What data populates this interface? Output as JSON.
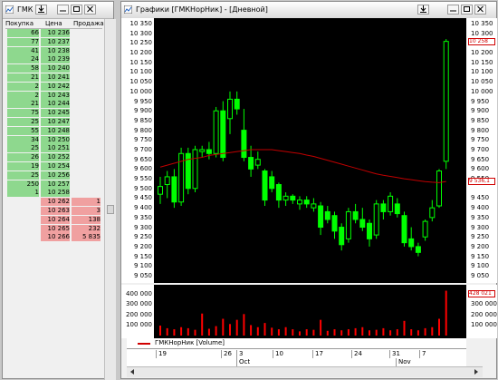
{
  "orderbook": {
    "title": "ГМК",
    "columns": [
      "Покупка",
      "Цена",
      "Продажа"
    ],
    "rows": [
      {
        "buy": "66",
        "price": "10 236",
        "sell": ""
      },
      {
        "buy": "77",
        "price": "10 237",
        "sell": ""
      },
      {
        "buy": "41",
        "price": "10 238",
        "sell": ""
      },
      {
        "buy": "24",
        "price": "10 239",
        "sell": ""
      },
      {
        "buy": "58",
        "price": "10 240",
        "sell": ""
      },
      {
        "buy": "21",
        "price": "10 241",
        "sell": ""
      },
      {
        "buy": "2",
        "price": "10 242",
        "sell": ""
      },
      {
        "buy": "2",
        "price": "10 243",
        "sell": ""
      },
      {
        "buy": "21",
        "price": "10 244",
        "sell": ""
      },
      {
        "buy": "75",
        "price": "10 245",
        "sell": ""
      },
      {
        "buy": "25",
        "price": "10 247",
        "sell": ""
      },
      {
        "buy": "55",
        "price": "10 248",
        "sell": ""
      },
      {
        "buy": "34",
        "price": "10 250",
        "sell": ""
      },
      {
        "buy": "25",
        "price": "10 251",
        "sell": ""
      },
      {
        "buy": "26",
        "price": "10 252",
        "sell": ""
      },
      {
        "buy": "19",
        "price": "10 254",
        "sell": ""
      },
      {
        "buy": "25",
        "price": "10 256",
        "sell": ""
      },
      {
        "buy": "250",
        "price": "10 257",
        "sell": ""
      },
      {
        "buy": "1",
        "price": "10 258",
        "sell": ""
      },
      {
        "buy": "",
        "price": "10 262",
        "sell": "1"
      },
      {
        "buy": "",
        "price": "10 263",
        "sell": "3"
      },
      {
        "buy": "",
        "price": "10 264",
        "sell": "138"
      },
      {
        "buy": "",
        "price": "10 265",
        "sell": "232"
      },
      {
        "buy": "",
        "price": "10 266",
        "sell": "5 835"
      }
    ]
  },
  "chart_window": {
    "title": "Графики [ГМКНорНик] - [Дневной]",
    "price_axis_ticks": [
      "10 350",
      "10 300",
      "10 250",
      "10 200",
      "10 150",
      "10 100",
      "10 050",
      "10 000",
      "9 950",
      "9 900",
      "9 850",
      "9 800",
      "9 750",
      "9 700",
      "9 650",
      "9 600",
      "9 550",
      "9 500",
      "9 450",
      "9 400",
      "9 350",
      "9 300",
      "9 250",
      "9 200",
      "9 150",
      "9 100",
      "9 050"
    ],
    "right_price_ticks": [
      "10 350",
      "10 300",
      "10 200",
      "10 150",
      "10 100",
      "10 050",
      "10 000",
      "9 950",
      "9 900",
      "9 850",
      "9 800",
      "9 750",
      "9 700",
      "9 650",
      "9 600",
      "9 550",
      "9 450",
      "9 400",
      "9 350",
      "9 300",
      "9 250",
      "9 200",
      "9 150",
      "9 100",
      "9 050"
    ],
    "last_price_label": "10 258",
    "ma_price_label": "9 536,1",
    "volume_axis_ticks": [
      "400 000",
      "300 000",
      "200 000",
      "100 000"
    ],
    "right_volume_ticks": [
      "300 000",
      "200 000",
      "100 000"
    ],
    "last_volume_label": "428 021",
    "legend_label": "ГМКНорНик [Volume]",
    "x_day_labels": [
      "19",
      "26",
      "3",
      "10",
      "17",
      "24",
      "31",
      "7"
    ],
    "x_month_labels": [
      "Oct",
      "Nov"
    ],
    "colors": {
      "up": "#00ff00",
      "down": "#00ff00",
      "ma": "#c00000",
      "volume": "#ff0000",
      "plot_bg": "#000000"
    }
  },
  "chart_data": {
    "type": "candlestick",
    "ylim": [
      9050,
      10350
    ],
    "candles": [
      {
        "o": 9470,
        "h": 9560,
        "l": 9420,
        "c": 9510
      },
      {
        "o": 9520,
        "h": 9590,
        "l": 9450,
        "c": 9560
      },
      {
        "o": 9560,
        "h": 9600,
        "l": 9400,
        "c": 9430
      },
      {
        "o": 9430,
        "h": 9710,
        "l": 9410,
        "c": 9680
      },
      {
        "o": 9680,
        "h": 9710,
        "l": 9470,
        "c": 9500
      },
      {
        "o": 9500,
        "h": 9720,
        "l": 9480,
        "c": 9700
      },
      {
        "o": 9690,
        "h": 9720,
        "l": 9660,
        "c": 9700
      },
      {
        "o": 9700,
        "h": 9740,
        "l": 9650,
        "c": 9680
      },
      {
        "o": 9680,
        "h": 9920,
        "l": 9660,
        "c": 9900
      },
      {
        "o": 9900,
        "h": 9950,
        "l": 9640,
        "c": 9660
      },
      {
        "o": 9860,
        "h": 10000,
        "l": 9780,
        "c": 9960
      },
      {
        "o": 9960,
        "h": 10000,
        "l": 9880,
        "c": 9910
      },
      {
        "o": 9800,
        "h": 9910,
        "l": 9640,
        "c": 9660
      },
      {
        "o": 9660,
        "h": 9720,
        "l": 9560,
        "c": 9600
      },
      {
        "o": 9620,
        "h": 9690,
        "l": 9600,
        "c": 9650
      },
      {
        "o": 9590,
        "h": 9600,
        "l": 9410,
        "c": 9440
      },
      {
        "o": 9560,
        "h": 9590,
        "l": 9480,
        "c": 9500
      },
      {
        "o": 9520,
        "h": 9530,
        "l": 9400,
        "c": 9440
      },
      {
        "o": 9440,
        "h": 9480,
        "l": 9410,
        "c": 9460
      },
      {
        "o": 9460,
        "h": 9470,
        "l": 9420,
        "c": 9440
      },
      {
        "o": 9420,
        "h": 9460,
        "l": 9390,
        "c": 9440
      },
      {
        "o": 9440,
        "h": 9460,
        "l": 9400,
        "c": 9420
      },
      {
        "o": 9400,
        "h": 9450,
        "l": 9380,
        "c": 9420
      },
      {
        "o": 9410,
        "h": 9430,
        "l": 9260,
        "c": 9300
      },
      {
        "o": 9380,
        "h": 9410,
        "l": 9320,
        "c": 9340
      },
      {
        "o": 9360,
        "h": 9380,
        "l": 9240,
        "c": 9280
      },
      {
        "o": 9300,
        "h": 9320,
        "l": 9180,
        "c": 9210
      },
      {
        "o": 9240,
        "h": 9400,
        "l": 9220,
        "c": 9380
      },
      {
        "o": 9380,
        "h": 9420,
        "l": 9320,
        "c": 9340
      },
      {
        "o": 9340,
        "h": 9400,
        "l": 9280,
        "c": 9300
      },
      {
        "o": 9320,
        "h": 9340,
        "l": 9200,
        "c": 9240
      },
      {
        "o": 9260,
        "h": 9440,
        "l": 9240,
        "c": 9420
      },
      {
        "o": 9420,
        "h": 9440,
        "l": 9340,
        "c": 9380
      },
      {
        "o": 9380,
        "h": 9480,
        "l": 9360,
        "c": 9460
      },
      {
        "o": 9420,
        "h": 9450,
        "l": 9350,
        "c": 9370
      },
      {
        "o": 9360,
        "h": 9380,
        "l": 9200,
        "c": 9220
      },
      {
        "o": 9240,
        "h": 9300,
        "l": 9180,
        "c": 9200
      },
      {
        "o": 9200,
        "h": 9220,
        "l": 9150,
        "c": 9170
      },
      {
        "o": 9250,
        "h": 9340,
        "l": 9230,
        "c": 9330
      },
      {
        "o": 9350,
        "h": 9440,
        "l": 9330,
        "c": 9400
      },
      {
        "o": 9410,
        "h": 9600,
        "l": 9400,
        "c": 9590
      },
      {
        "o": 9640,
        "h": 10270,
        "l": 9600,
        "c": 10258
      }
    ],
    "ma": [
      9610,
      9620,
      9630,
      9640,
      9650,
      9655,
      9660,
      9670,
      9675,
      9680,
      9685,
      9690,
      9695,
      9700,
      9700,
      9700,
      9700,
      9695,
      9690,
      9685,
      9680,
      9672,
      9665,
      9655,
      9645,
      9635,
      9625,
      9615,
      9605,
      9595,
      9585,
      9575,
      9568,
      9562,
      9556,
      9550,
      9545,
      9540,
      9535,
      9532,
      9530,
      9536
    ],
    "volume": [
      95000,
      70000,
      60000,
      80000,
      70000,
      55000,
      210000,
      65000,
      90000,
      160000,
      110000,
      150000,
      205000,
      100000,
      80000,
      120000,
      75000,
      60000,
      80000,
      60000,
      40000,
      60000,
      55000,
      150000,
      45000,
      60000,
      50000,
      60000,
      70000,
      80000,
      50000,
      55000,
      70000,
      50000,
      60000,
      140000,
      60000,
      50000,
      70000,
      80000,
      160000,
      428021
    ],
    "volume_ylim": [
      0,
      450000
    ]
  }
}
